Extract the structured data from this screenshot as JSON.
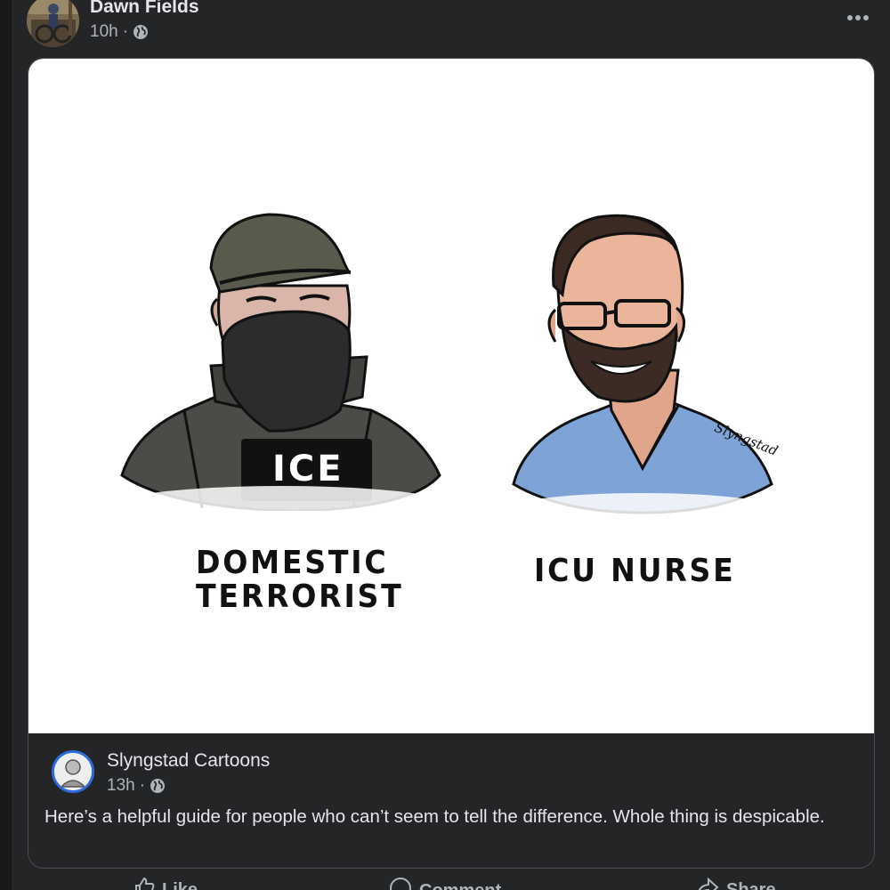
{
  "post": {
    "author": "Dawn Fields",
    "time": "10h",
    "separator": "·",
    "privacy_icon": "globe-icon",
    "more_icon": "more-options-icon"
  },
  "shared": {
    "cartoon": {
      "patch_label": "ICE",
      "left_caption_line1": "DOMESTIC",
      "left_caption_line2": "TERRORIST",
      "right_caption": "ICU NURSE",
      "signature": "Slyngstad"
    },
    "author": "Slyngstad Cartoons",
    "time": "13h",
    "separator": "·",
    "text": "Here’s a helpful guide for people who can’t seem to tell the difference. Whole thing is despicable."
  },
  "actions": {
    "like_label": "Like",
    "comment_label": "Comment",
    "share_label": "Share"
  },
  "colors": {
    "background": "#242526",
    "card_border": "#4a4c50",
    "text_primary": "#e4e6eb",
    "text_secondary": "#b0b3b8",
    "avatar_ring": "#2d6ae0"
  }
}
